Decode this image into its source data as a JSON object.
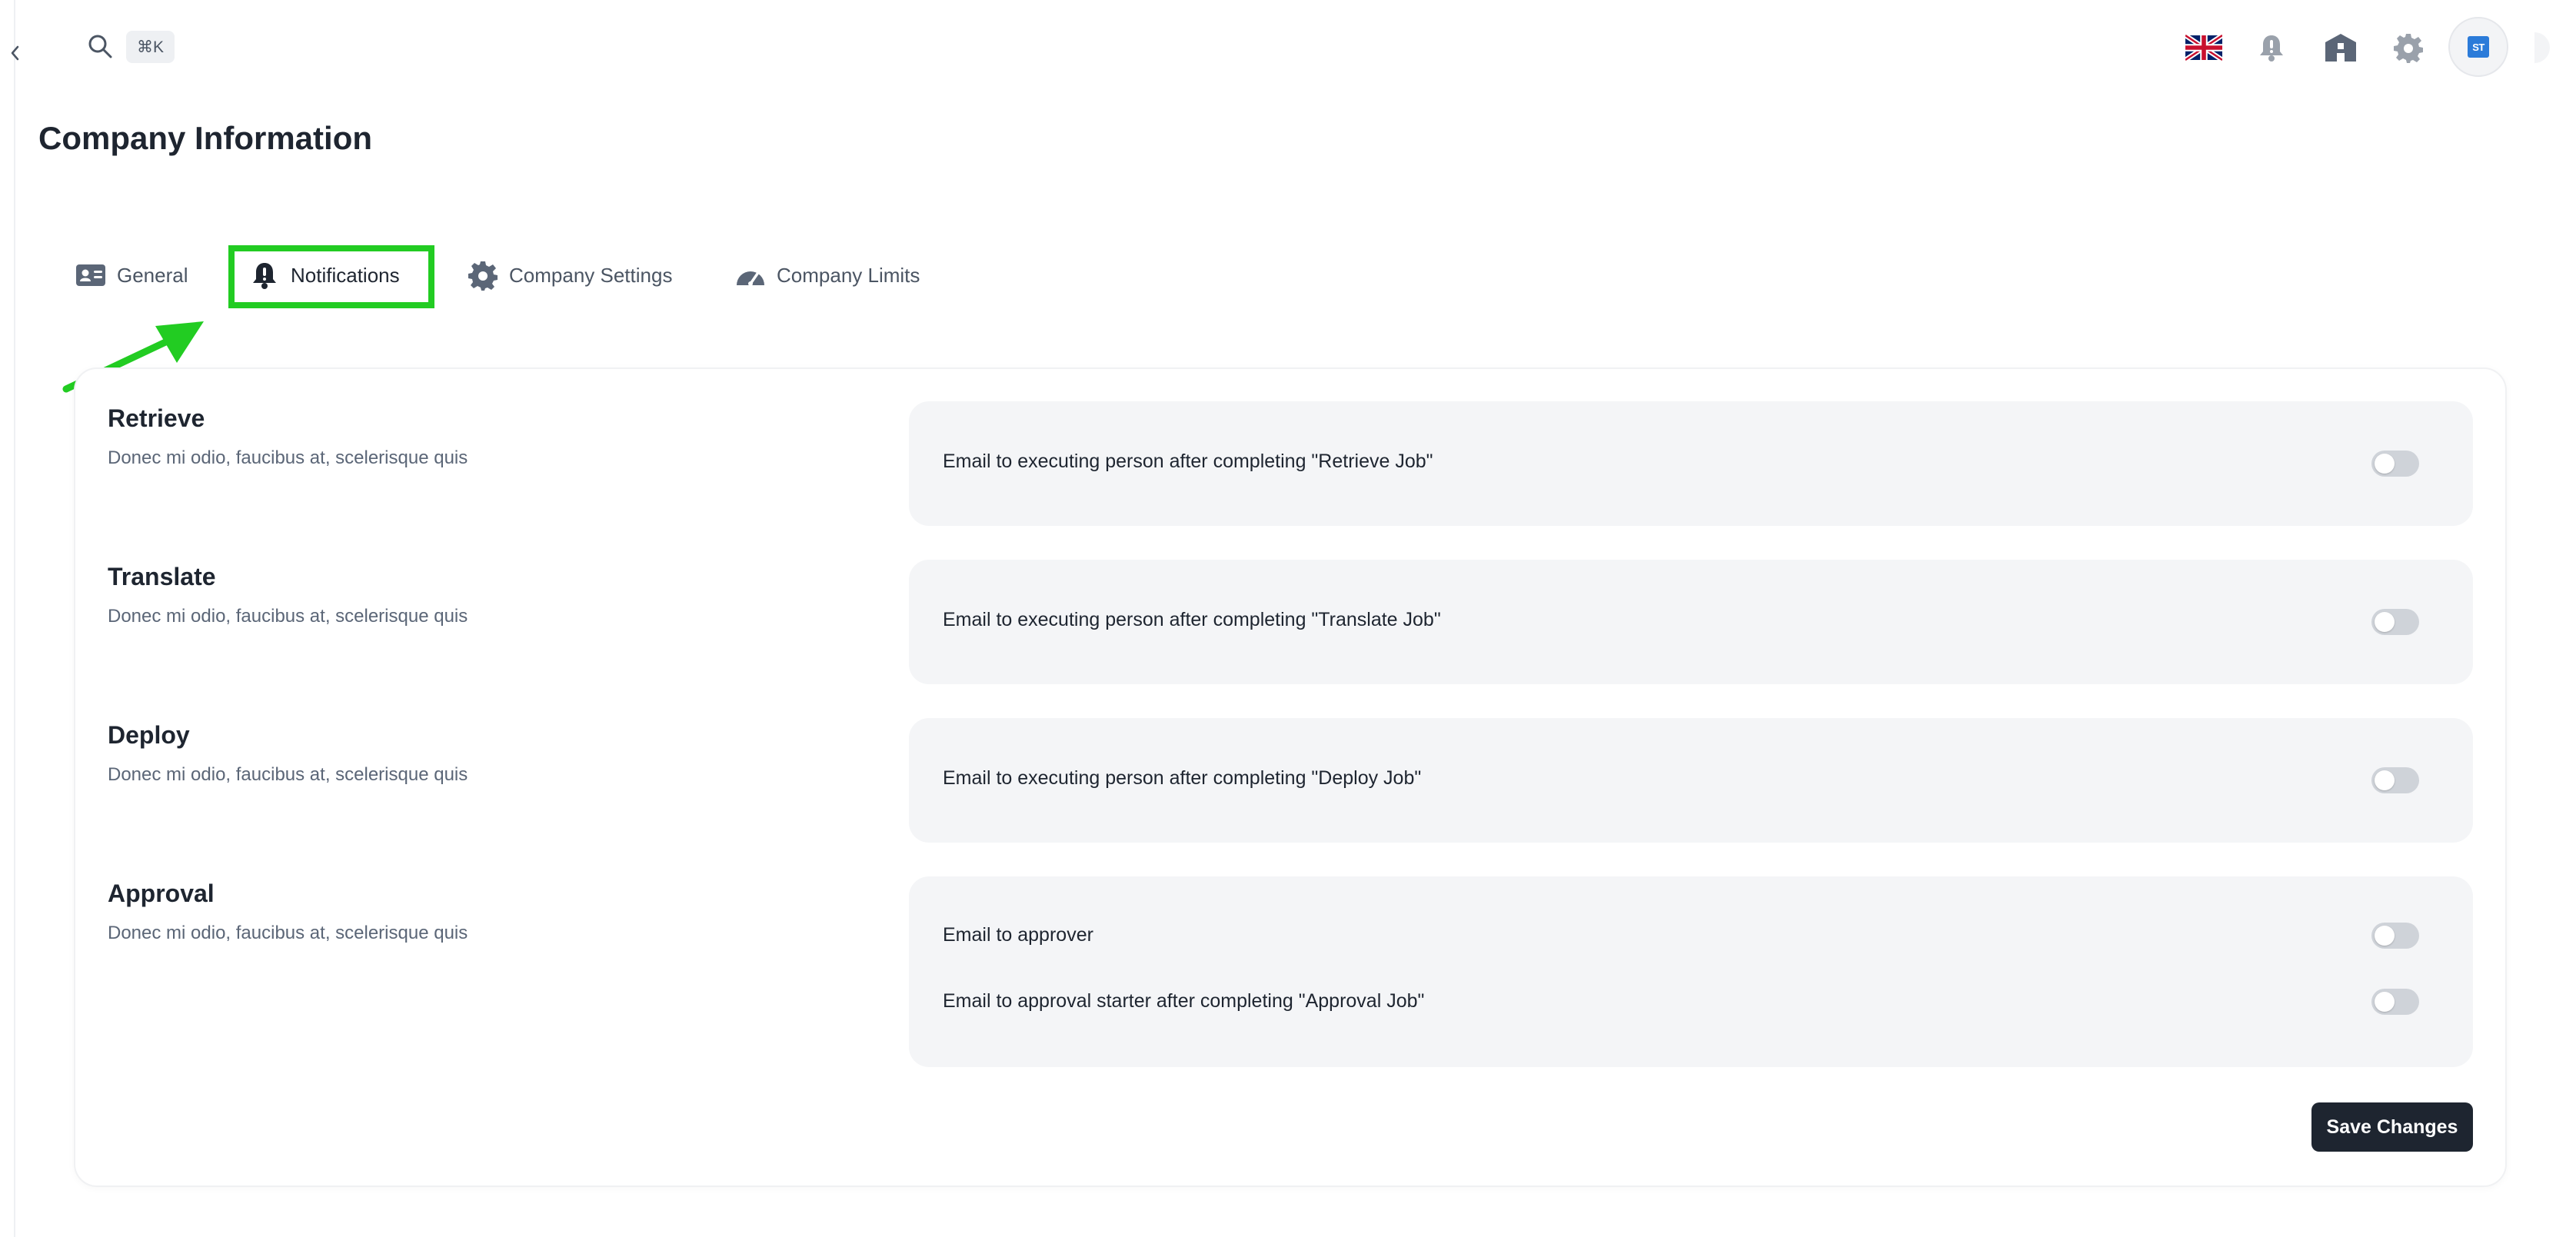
{
  "header": {
    "search_shortcut": "⌘K",
    "icons": [
      "search-icon",
      "uk-flag-icon",
      "bell-icon",
      "building-icon",
      "gear-icon",
      "avatar-icon"
    ],
    "avatar_initials": "ST"
  },
  "page": {
    "title": "Company Information"
  },
  "tabs": [
    {
      "label": "General",
      "icon": "id-card-icon",
      "active": false
    },
    {
      "label": "Notifications",
      "icon": "bell-icon",
      "active": true
    },
    {
      "label": "Company Settings",
      "icon": "gear-icon",
      "active": false
    },
    {
      "label": "Company Limits",
      "icon": "gauge-icon",
      "active": false
    }
  ],
  "annotation": {
    "highlight_color": "#22cc22"
  },
  "sections": [
    {
      "title": "Retrieve",
      "description": "Donec mi odio, faucibus at, scelerisque quis",
      "options": [
        {
          "label": "Email to executing person after completing \"Retrieve Job\"",
          "enabled": false
        }
      ]
    },
    {
      "title": "Translate",
      "description": "Donec mi odio, faucibus at, scelerisque quis",
      "options": [
        {
          "label": "Email to executing person after completing \"Translate Job\"",
          "enabled": false
        }
      ]
    },
    {
      "title": "Deploy",
      "description": "Donec mi odio, faucibus at, scelerisque quis",
      "options": [
        {
          "label": "Email to executing person after completing \"Deploy Job\"",
          "enabled": false
        }
      ]
    },
    {
      "title": "Approval",
      "description": "Donec mi odio, faucibus at, scelerisque quis",
      "options": [
        {
          "label": "Email to approver",
          "enabled": false
        },
        {
          "label": "Email to approval starter after completing \"Approval Job\"",
          "enabled": false
        }
      ]
    }
  ],
  "actions": {
    "save_label": "Save Changes"
  },
  "colors": {
    "primary_dark": "#1e2530",
    "panel_bg": "#f4f5f7",
    "toggle_off": "#cfd3d9"
  }
}
